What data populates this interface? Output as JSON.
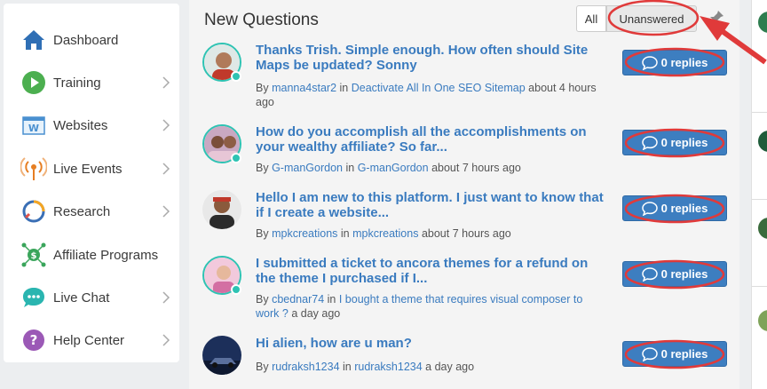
{
  "sidebar": {
    "items": [
      {
        "label": "Dashboard",
        "icon": "home-icon",
        "chevron": false
      },
      {
        "label": "Training",
        "icon": "play-icon",
        "chevron": true
      },
      {
        "label": "Websites",
        "icon": "website-icon",
        "chevron": true
      },
      {
        "label": "Live Events",
        "icon": "broadcast-icon",
        "chevron": true
      },
      {
        "label": "Research",
        "icon": "research-icon",
        "chevron": true
      },
      {
        "label": "Affiliate Programs",
        "icon": "affiliate-icon",
        "chevron": false
      },
      {
        "label": "Live Chat",
        "icon": "chat-icon",
        "chevron": true
      },
      {
        "label": "Help Center",
        "icon": "help-icon",
        "chevron": true
      }
    ]
  },
  "main": {
    "title": "New Questions",
    "filters": {
      "all": "All",
      "unanswered": "Unanswered"
    },
    "questions": [
      {
        "title": "Thanks Trish. Simple enough. How often should Site Maps be updated? Sonny",
        "by": "By",
        "author": "manna4star2",
        "in": "in",
        "location": "Deactivate All In One SEO Sitemap",
        "time": "about 4 hours ago",
        "replies": "0 replies"
      },
      {
        "title": "How do you accomplish all the accomplishments on your wealthy affiliate? So far...",
        "by": "By",
        "author": "G-manGordon",
        "in": "in",
        "location": "G-manGordon",
        "time": "about 7 hours ago",
        "replies": "0 replies"
      },
      {
        "title": "Hello I am new to this platform. I just want to know that if I create a website...",
        "by": "By",
        "author": "mpkcreations",
        "in": "in",
        "location": "mpkcreations",
        "time": "about 7 hours ago",
        "replies": "0 replies"
      },
      {
        "title": "I submitted a ticket to ancora themes for a refund on the theme I purchased if I...",
        "by": "By",
        "author": "cbednar74",
        "in": "in",
        "location": "I bought a theme that requires visual composer to work ?",
        "time": "a day ago",
        "replies": "0 replies"
      },
      {
        "title": "Hi alien, how are u man?",
        "by": "By",
        "author": "rudraksh1234",
        "in": "in",
        "location": "rudraksh1234",
        "time": "a day ago",
        "replies": "0 replies"
      }
    ]
  },
  "colors": {
    "link": "#3a7bbf",
    "reply_button": "#3d7ec0",
    "annotation": "#e03a3a",
    "accent": "#2ec3b3"
  }
}
